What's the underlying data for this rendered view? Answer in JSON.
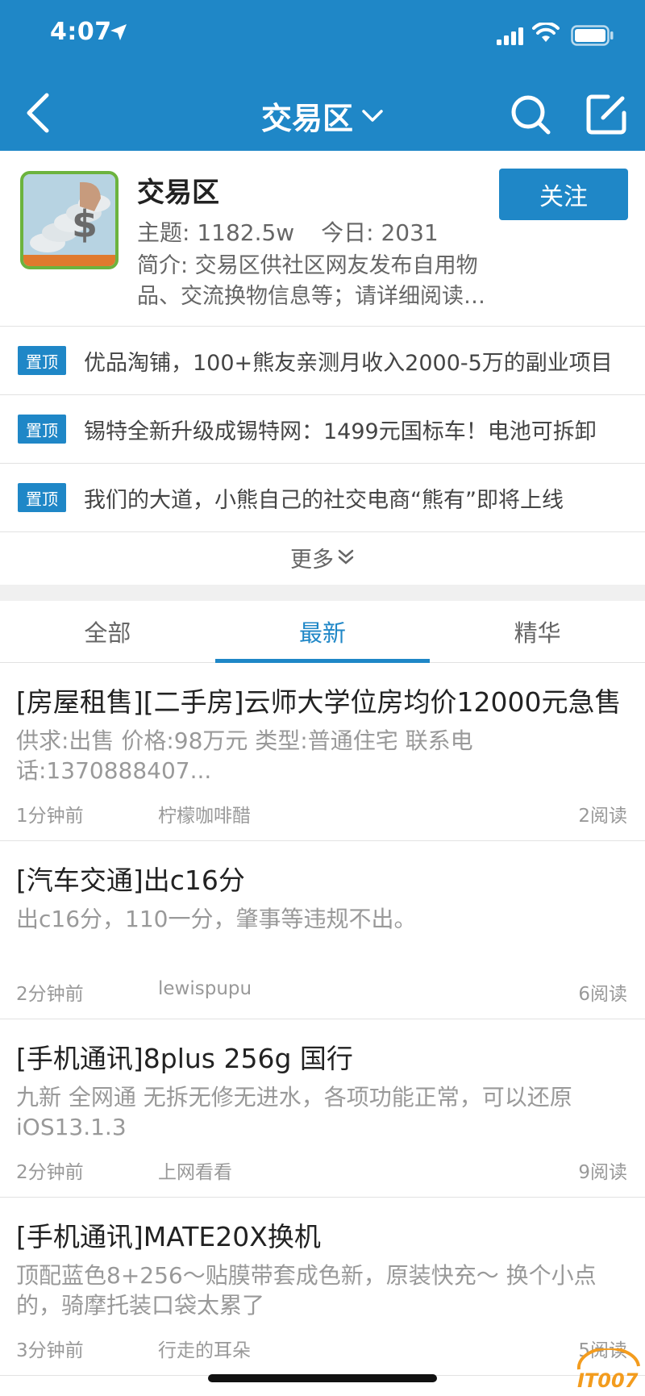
{
  "status_bar": {
    "time": "4:07"
  },
  "nav": {
    "title": "交易区"
  },
  "forum": {
    "name": "交易区",
    "topics": "主题: 1182.5w",
    "today": "今日: 2031",
    "description": "简介: 交易区供社区网友发布自用物品、交流换物信息等；请详细阅读版规",
    "follow_label": "关注"
  },
  "pinned": {
    "badge": "置顶",
    "items": [
      {
        "text": "优品淘铺，100+熊友亲测月收入2000-5万的副业项目"
      },
      {
        "text": "锡特全新升级成锡特网：1499元国标车！电池可拆卸"
      },
      {
        "text": "我们的大道，小熊自己的社交电商“熊有”即将上线"
      }
    ],
    "more_label": "更多"
  },
  "tabs": [
    {
      "label": "全部",
      "active": false
    },
    {
      "label": "最新",
      "active": true
    },
    {
      "label": "精华",
      "active": false
    }
  ],
  "posts": [
    {
      "title": "[房屋租售][二手房]云师大学位房均价12000元急售",
      "excerpt": "供求:出售  价格:98万元  类型:普通住宅  联系电话:1370888407...",
      "time": "1分钟前",
      "author": "柠檬咖啡醋",
      "reads": "2阅读"
    },
    {
      "title": "[汽车交通]出c16分",
      "excerpt": "出c16分，110一分，肇事等违规不出。",
      "time": "2分钟前",
      "author": "lewispupu",
      "reads": "6阅读"
    },
    {
      "title": "[手机通讯]8plus 256g 国行",
      "excerpt": "九新 全网通 无拆无修无进水，各项功能正常，可以还原iOS13.1.3",
      "time": "2分钟前",
      "author": "上网看看",
      "reads": "9阅读"
    },
    {
      "title": "[手机通讯]MATE20X换机",
      "excerpt": "顶配蓝色8+256～贴膜带套成色新，原装快充～ 换个小点的，骑摩托装口袋太累了",
      "time": "3分钟前",
      "author": "行走的耳朵",
      "reads": "5阅读"
    }
  ],
  "watermark": "IT007",
  "colors": {
    "primary": "#1f87c7",
    "text": "#222222",
    "muted": "#999999"
  }
}
